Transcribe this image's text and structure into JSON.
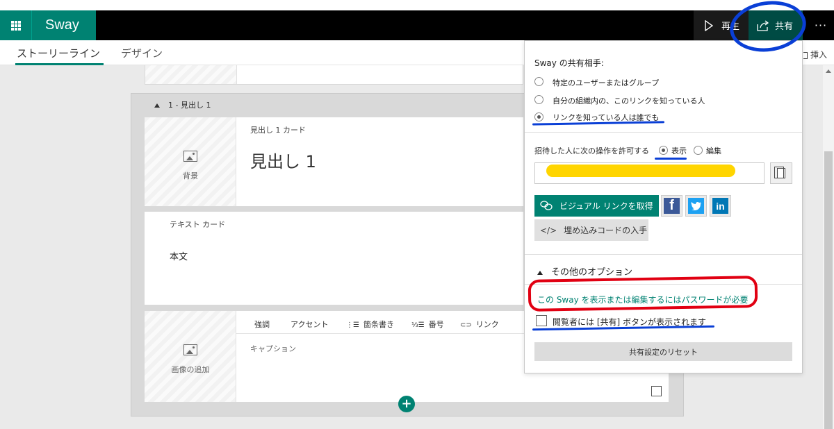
{
  "app": {
    "name": "Sway",
    "play_label": "再生",
    "share_label": "共有",
    "more_label": "···"
  },
  "tabs": {
    "storyline": "ストーリーライン",
    "design": "デザイン",
    "insert": "挿入"
  },
  "editor": {
    "section_title": "1 - 見出し 1",
    "heading_card": {
      "type_label": "見出し 1 カード",
      "title": "見出し 1",
      "background_label": "背景"
    },
    "text_card": {
      "type_label": "テキスト カード",
      "body": "本文"
    },
    "image_card": {
      "toolbar": {
        "emphasis": "強調",
        "accent": "アクセント",
        "bullets": "箇条書き",
        "numbering": "番号",
        "link": "リンク"
      },
      "caption_placeholder": "キャプション",
      "add_image_label": "画像の追加"
    },
    "add_button": "+"
  },
  "share_panel": {
    "heading": "Sway の共有相手:",
    "options": [
      {
        "label": "特定のユーザーまたはグループ",
        "selected": false
      },
      {
        "label": "自分の組織内の、このリンクを知っている人",
        "selected": false
      },
      {
        "label": "リンクを知っている人は誰でも",
        "selected": true
      }
    ],
    "permission_label": "招待した人に次の操作を許可する",
    "permission_options": [
      {
        "label": "表示",
        "selected": true
      },
      {
        "label": "編集",
        "selected": false
      }
    ],
    "visual_link_button": "ビジュアル リンクを取得",
    "social": {
      "facebook": "f",
      "twitter": "t",
      "linkedin": "in"
    },
    "embed_button": "埋め込みコードの入手",
    "embed_icon": "</>",
    "more_options_label": "その他のオプション",
    "password_link": "この Sway を表示または編集するにはパスワードが必要",
    "viewer_share_label": "閲覧者には [共有] ボタンが表示されます",
    "viewer_share_checked": false,
    "reset_button": "共有設定のリセット"
  },
  "colors": {
    "brand": "#008272",
    "topbar": "#000000",
    "share_active": "#004b44",
    "facebook": "#3b5998",
    "twitter": "#1da1f2",
    "linkedin": "#0077b5",
    "annotation_blue": "#0a3fd6",
    "annotation_red": "#e10012",
    "annotation_yellow": "#ffd500"
  }
}
